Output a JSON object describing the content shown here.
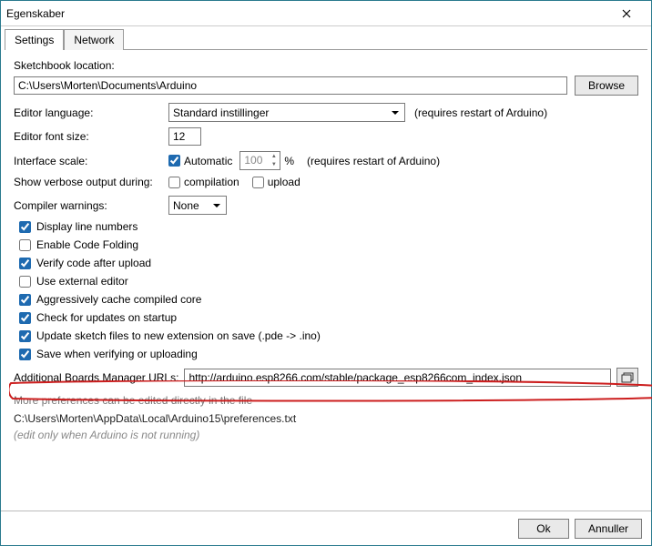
{
  "window": {
    "title": "Egenskaber"
  },
  "tabs": {
    "settings": "Settings",
    "network": "Network"
  },
  "sketchbook": {
    "label": "Sketchbook location:",
    "value": "C:\\Users\\Morten\\Documents\\Arduino",
    "browse": "Browse"
  },
  "editor_language": {
    "label": "Editor language:",
    "value": "Standard instillinger",
    "note": "(requires restart of Arduino)"
  },
  "font_size": {
    "label": "Editor font size:",
    "value": "12"
  },
  "interface_scale": {
    "label": "Interface scale:",
    "automatic_label": "Automatic",
    "automatic_checked": true,
    "value": "100",
    "unit": "%",
    "note": "(requires restart of Arduino)"
  },
  "verbose": {
    "label": "Show verbose output during:",
    "compilation": "compilation",
    "compilation_checked": false,
    "upload": "upload",
    "upload_checked": false
  },
  "compiler_warnings": {
    "label": "Compiler warnings:",
    "value": "None"
  },
  "checks": [
    {
      "label": "Display line numbers",
      "checked": true
    },
    {
      "label": "Enable Code Folding",
      "checked": false
    },
    {
      "label": "Verify code after upload",
      "checked": true
    },
    {
      "label": "Use external editor",
      "checked": false
    },
    {
      "label": "Aggressively cache compiled core",
      "checked": true
    },
    {
      "label": "Check for updates on startup",
      "checked": true
    },
    {
      "label": "Update sketch files to new extension on save (.pde -> .ino)",
      "checked": true
    },
    {
      "label": "Save when verifying or uploading",
      "checked": true
    }
  ],
  "additional": {
    "label": "Additional Boards Manager URLs:",
    "value": "http://arduino.esp8266.com/stable/package_esp8266com_index.json"
  },
  "more": "More preferences can be edited directly in the file",
  "prefpath": "C:\\Users\\Morten\\AppData\\Local\\Arduino15\\preferences.txt",
  "editnote": "(edit only when Arduino is not running)",
  "footer": {
    "ok": "Ok",
    "cancel": "Annuller"
  }
}
